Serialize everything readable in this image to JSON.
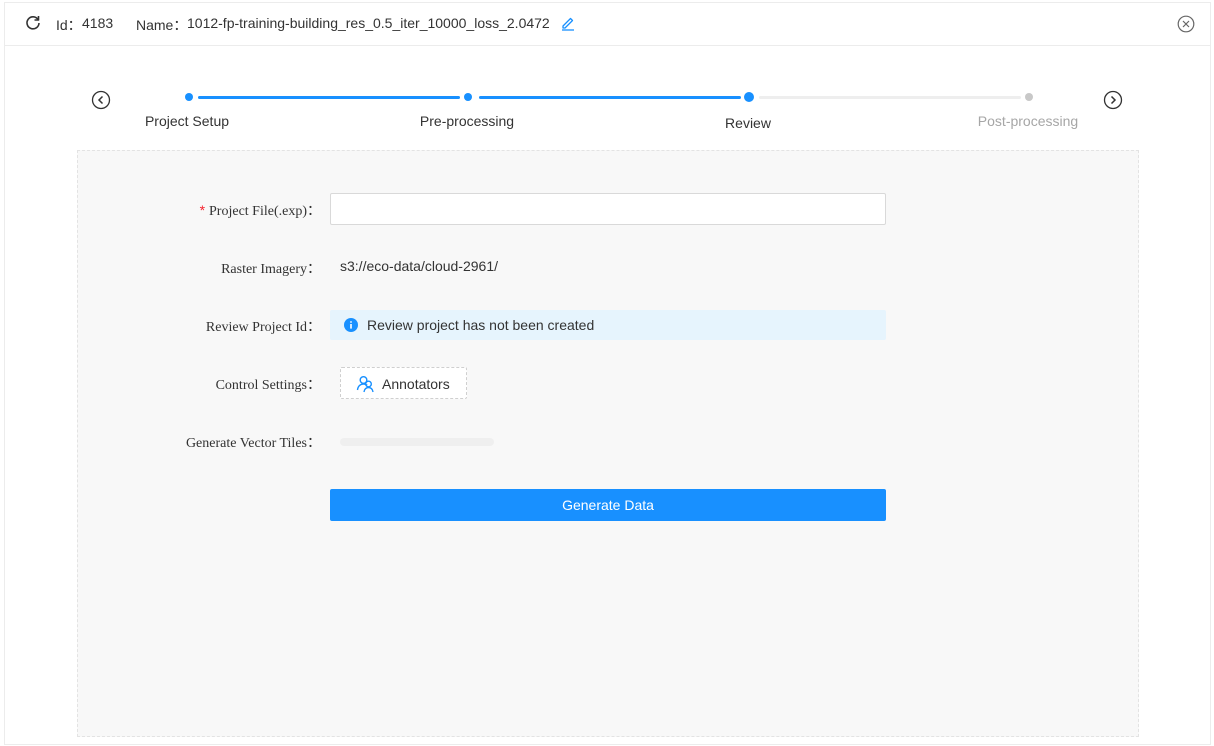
{
  "header": {
    "id_label": "Id：",
    "id_value": "4183",
    "name_label": "Name：",
    "name_value": "1012-fp-training-building_res_0.5_iter_10000_loss_2.0472"
  },
  "steps": {
    "items": [
      {
        "title": "Project Setup",
        "state": "done"
      },
      {
        "title": "Pre-processing",
        "state": "done"
      },
      {
        "title": "Review",
        "state": "current"
      },
      {
        "title": "Post-processing",
        "state": "pending"
      }
    ],
    "active_color": "#1890ff",
    "inactive_color": "#c8c8c8"
  },
  "form": {
    "project_file": {
      "label": "Project File(.exp)：",
      "required_mark": "*",
      "value": "",
      "placeholder": ""
    },
    "raster_imagery": {
      "label": "Raster Imagery：",
      "value": "s3://eco-data/cloud-2961/"
    },
    "review_project_id": {
      "label": "Review Project Id：",
      "info": "Review project has not been created"
    },
    "control_settings": {
      "label": "Control Settings：",
      "button": "Annotators"
    },
    "generate_vector_tiles": {
      "label": "Generate Vector Tiles：",
      "progress": 0
    },
    "submit": "Generate Data"
  },
  "icons": {
    "refresh": "refresh-icon",
    "edit": "edit-icon",
    "close": "close-circle-icon",
    "prev": "chevron-left-circle-icon",
    "next": "chevron-right-circle-icon",
    "info": "info-circle-icon",
    "annotators": "team-icon"
  }
}
